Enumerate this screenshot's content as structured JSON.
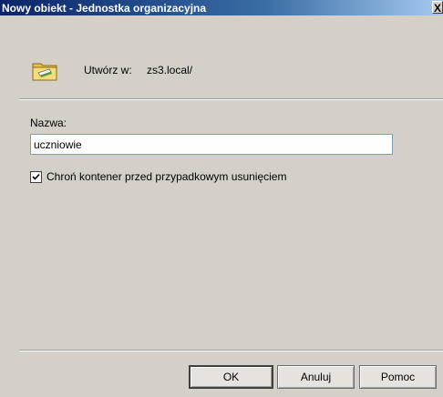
{
  "window": {
    "title": "Nowy obiekt - Jednostka organizacyjna",
    "close_glyph": "X"
  },
  "header": {
    "create_in_label": "Utwórz w:",
    "create_in_path": "zs3.local/"
  },
  "form": {
    "name_label": "Nazwa:",
    "name_value": "uczniowie",
    "protect_label": "Chroń kontener przed przypadkowym usunięciem",
    "protect_checked": true
  },
  "buttons": {
    "ok": "OK",
    "cancel": "Anuluj",
    "help": "Pomoc"
  },
  "icons": {
    "header_icon": "organizational-unit-folder-icon",
    "checkbox_mark": "checkmark-icon"
  },
  "colors": {
    "titlebar_start": "#0a246a",
    "titlebar_end": "#a6caf0",
    "dialog_bg": "#d4d0c8",
    "folder": "#f2d16b"
  }
}
